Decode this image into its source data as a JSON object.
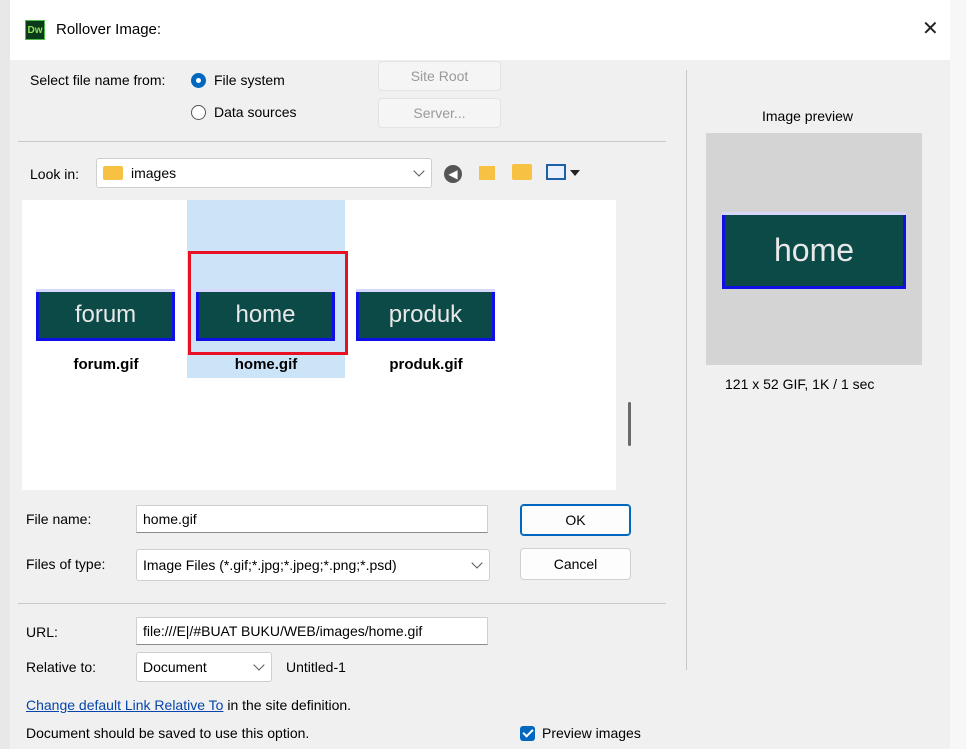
{
  "window": {
    "app_icon": "Dw",
    "title": "Rollover Image:",
    "close_glyph": "✕"
  },
  "source": {
    "label": "Select file name from:",
    "options": [
      {
        "label": "File system",
        "selected": true
      },
      {
        "label": "Data sources",
        "selected": false
      }
    ],
    "site_root_button": "Site Root",
    "server_button": "Server..."
  },
  "lookin": {
    "label": "Look in:",
    "folder": "images"
  },
  "files": [
    {
      "thumb_text": "forum",
      "name": "forum.gif"
    },
    {
      "thumb_text": "home",
      "name": "home.gif",
      "selected": true
    },
    {
      "thumb_text": "produk",
      "name": "produk.gif"
    }
  ],
  "filename": {
    "label": "File name:",
    "value": "home.gif"
  },
  "filetype": {
    "label": "Files of type:",
    "value": "Image Files (*.gif;*.jpg;*.jpeg;*.png;*.psd)"
  },
  "buttons": {
    "ok": "OK",
    "cancel": "Cancel"
  },
  "url": {
    "label": "URL:",
    "value": "file:///E|/#BUAT BUKU/WEB/images/home.gif"
  },
  "relative": {
    "label": "Relative to:",
    "value": "Document",
    "doc_name": "Untitled-1"
  },
  "footer": {
    "link_text": "Change default Link Relative To",
    "link_suffix": " in the site definition.",
    "note": "Document should be saved to use this option.",
    "preview_checkbox": "Preview images",
    "preview_checked": true
  },
  "preview": {
    "title": "Image preview",
    "image_text": "home",
    "info": "121 x 52 GIF, 1K / 1 sec"
  },
  "colors": {
    "accent": "#0067c0",
    "thumb_bg": "#0b4a47",
    "thumb_border": "#1010e6",
    "selection_bg": "#cce4f7",
    "highlight_box": "#e81123"
  }
}
